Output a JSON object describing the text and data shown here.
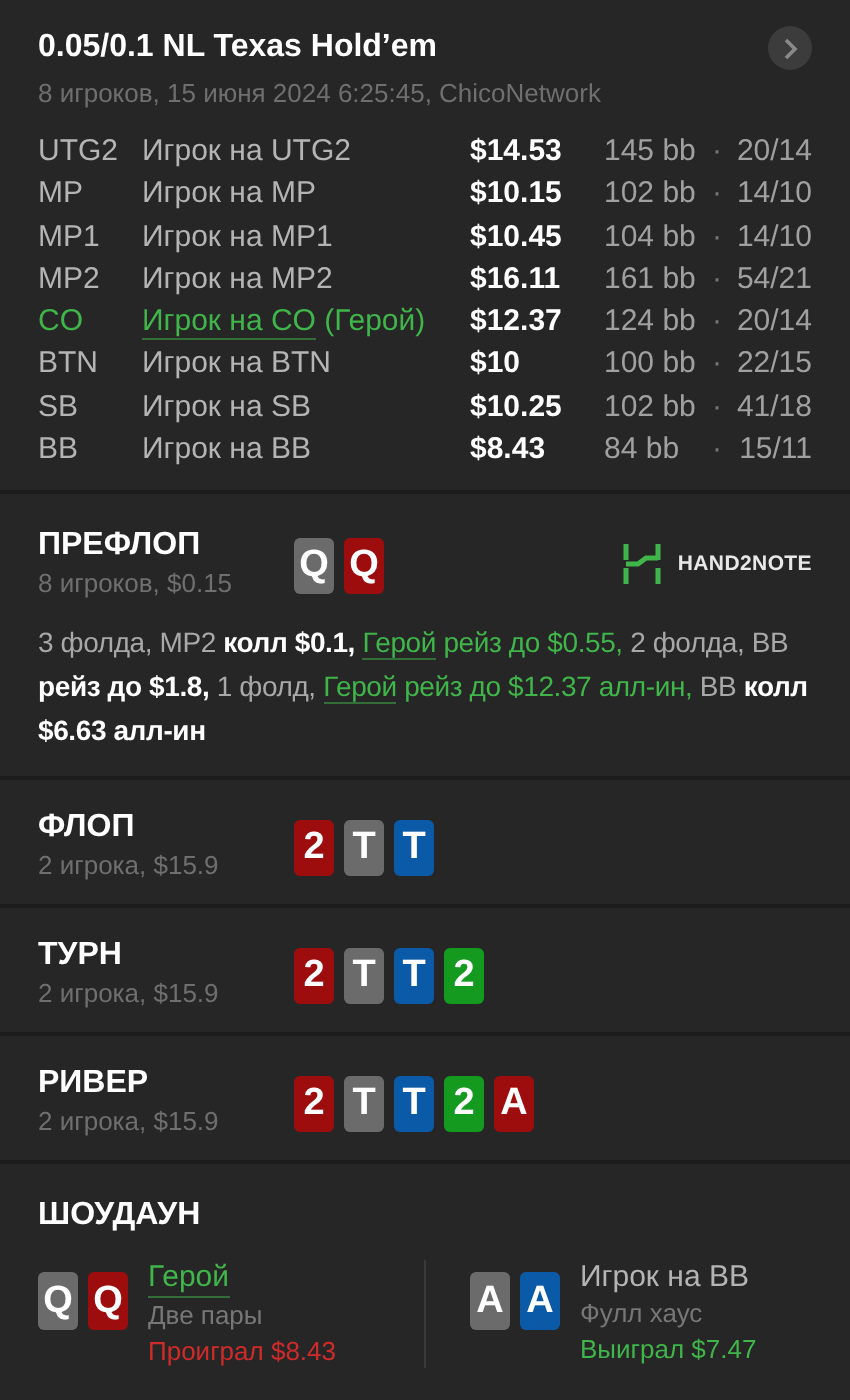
{
  "header": {
    "title": "0.05/0.1 NL Texas Hold’em",
    "subtitle": "8 игроков, 15 июня 2024 6:25:45, ChicoNetwork"
  },
  "players": [
    {
      "position": "UTG2",
      "name": "Игрок на UTG2",
      "hero": false,
      "stack": "$14.53",
      "bb": "145 bb",
      "sep": "·",
      "stats": "20/14"
    },
    {
      "position": "MP",
      "name": "Игрок на MP",
      "hero": false,
      "stack": "$10.15",
      "bb": "102 bb",
      "sep": "·",
      "stats": "14/10"
    },
    {
      "position": "MP1",
      "name": "Игрок на MP1",
      "hero": false,
      "stack": "$10.45",
      "bb": "104 bb",
      "sep": "·",
      "stats": "14/10"
    },
    {
      "position": "MP2",
      "name": "Игрок на MP2",
      "hero": false,
      "stack": "$16.11",
      "bb": "161 bb",
      "sep": "·",
      "stats": "54/21"
    },
    {
      "position": "CO",
      "name": "Игрок на CO",
      "tag": "(Герой)",
      "hero": true,
      "stack": "$12.37",
      "bb": "124 bb",
      "sep": "·",
      "stats": "20/14"
    },
    {
      "position": "BTN",
      "name": "Игрок на BTN",
      "hero": false,
      "stack": "$10",
      "bb": "100 bb",
      "sep": "·",
      "stats": "22/15"
    },
    {
      "position": "SB",
      "name": "Игрок на SB",
      "hero": false,
      "stack": "$10.25",
      "bb": "102 bb",
      "sep": "·",
      "stats": "41/18"
    },
    {
      "position": "BB",
      "name": "Игрок на BB",
      "hero": false,
      "stack": "$8.43",
      "bb": "84 bb",
      "sep": "·",
      "stats": "15/11"
    }
  ],
  "streets": [
    {
      "title": "ПРЕФЛОП",
      "info": "8 игроков, $0.15",
      "logo": "HAND2NOTE",
      "cards": [
        {
          "rank": "Q",
          "color": "#6b6b6b"
        },
        {
          "rank": "Q",
          "color": "#9e0d0d"
        }
      ],
      "actions": [
        {
          "kind": "muted",
          "text": "3 фолда, MP2 "
        },
        {
          "kind": "action",
          "text": "колл $0.1, "
        },
        {
          "kind": "link",
          "text": "Герой"
        },
        {
          "kind": "hero",
          "text": " рейз до $0.55,"
        },
        {
          "kind": "muted",
          "text": " 2 фолда, BB "
        },
        {
          "kind": "action",
          "text": "рейз до $1.8,"
        },
        {
          "kind": "muted",
          "text": " 1 фолд, "
        },
        {
          "kind": "link",
          "text": "Герой"
        },
        {
          "kind": "hero",
          "text": " рейз до $12.37 алл-ин,"
        },
        {
          "kind": "muted",
          "text": " BB "
        },
        {
          "kind": "action",
          "text": "колл $6.63 алл-ин"
        }
      ]
    },
    {
      "title": "ФЛОП",
      "info": "2 игрока, $15.9",
      "cards": [
        {
          "rank": "2",
          "color": "#9e0d0d"
        },
        {
          "rank": "T",
          "color": "#6b6b6b"
        },
        {
          "rank": "T",
          "color": "#0b5aa8"
        }
      ]
    },
    {
      "title": "ТУРН",
      "info": "2 игрока, $15.9",
      "cards": [
        {
          "rank": "2",
          "color": "#9e0d0d"
        },
        {
          "rank": "T",
          "color": "#6b6b6b"
        },
        {
          "rank": "T",
          "color": "#0b5aa8"
        },
        {
          "rank": "2",
          "color": "#139a1f"
        }
      ]
    },
    {
      "title": "РИВЕР",
      "info": "2 игрока, $15.9",
      "cards": [
        {
          "rank": "2",
          "color": "#9e0d0d"
        },
        {
          "rank": "T",
          "color": "#6b6b6b"
        },
        {
          "rank": "T",
          "color": "#0b5aa8"
        },
        {
          "rank": "2",
          "color": "#139a1f"
        },
        {
          "rank": "A",
          "color": "#9e0d0d"
        }
      ]
    }
  ],
  "showdown": {
    "title": "ШОУДАУН",
    "hands": [
      {
        "name": "Герой",
        "hero": true,
        "combo": "Две пары",
        "result": "Проиграл $8.43",
        "won": false,
        "cards": [
          {
            "rank": "Q",
            "color": "#6b6b6b"
          },
          {
            "rank": "Q",
            "color": "#9e0d0d"
          }
        ]
      },
      {
        "name": "Игрок на BB",
        "hero": false,
        "combo": "Фулл хаус",
        "result": "Выиграл $7.47",
        "won": true,
        "cards": [
          {
            "rank": "A",
            "color": "#6b6b6b"
          },
          {
            "rank": "A",
            "color": "#0b5aa8"
          }
        ]
      }
    ]
  }
}
